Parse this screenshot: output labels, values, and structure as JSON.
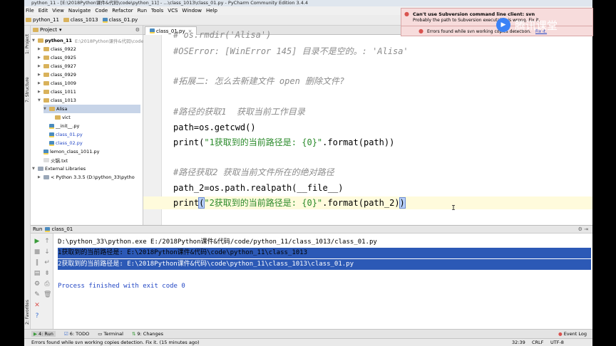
{
  "window": {
    "title": "python_11 - [E:\\2018Python课件&代码\\code\\python_11] - ...\\class_1013\\class_01.py - PyCharm Community Edition 3.4.4"
  },
  "menu": [
    "File",
    "Edit",
    "View",
    "Navigate",
    "Code",
    "Refactor",
    "Run",
    "Tools",
    "VCS",
    "Window",
    "Help"
  ],
  "breadcrumbs": [
    "python_11",
    "class_1013",
    "class_01.py"
  ],
  "project": {
    "header": "Project",
    "root": "python_11",
    "root_path": "E:\\2018Python课件&代码\\code\\python_11",
    "folders": [
      "class_0922",
      "class_0925",
      "class_0927",
      "class_0929",
      "class_1009",
      "class_1011",
      "class_1013"
    ],
    "alisa": "Alisa",
    "vict": "vict",
    "files": [
      "__init__.py",
      "class_01.py",
      "class_02.py"
    ],
    "lemon": "lemon_class_1011.py",
    "txt": "火锅.txt",
    "ext": "External Libraries",
    "py": "< Python 3.3.5 (D:\\python_33\\pytho"
  },
  "editor": {
    "tab": "class_01.py",
    "lines": {
      "l0": "# os.rmdir('Alisa')",
      "l1": "#OSError: [WinError 145] 目录不是空的。: 'Alisa'",
      "l2": "#拓展二: 怎么去新建文件 open 删除文件?",
      "l3": "#路径的获取1  获取当前工作目录",
      "l4": "path=os.getcwd()",
      "l5a": "print(",
      "l5s": "\"1获取到的当前路径是: {0}\"",
      "l5b": ".format(path))",
      "l6": "#路径获取2 获取当前文件所在的绝对路径",
      "l7": "path_2=os.path.realpath(__file__)",
      "l8a": "print",
      "l8p": "(",
      "l8s": "\"2获取到的当前路径是: {0}\"",
      "l8b": ".format(path_2)",
      "l8c": ")"
    }
  },
  "run": {
    "label": "Run",
    "config": "class_01",
    "console": [
      "D:\\python_33\\python.exe E:/2018Python课件&代码/code/python_11/class_1013/class_01.py",
      "1获取到的当前路径是: E:\\2018Python课件&代码\\code\\python_11\\class_1013",
      "2获取到的当前路径是: E:\\2018Python课件&代码\\code\\python_11\\class_1013\\class_01.py",
      "Process finished with exit code 0"
    ]
  },
  "left_tabs": {
    "project": "1: Project",
    "structure": "7: Structure",
    "favorites": "2: Favorites"
  },
  "bottom_tabs": [
    "4: Run",
    "6: TODO",
    "Terminal",
    "9: Changes"
  ],
  "event_log": "Event Log",
  "notification": {
    "title": "Can't use Subversion command line client: svn",
    "body": "Probably the path to Subversion executable is wrong. Fix it.",
    "error": "Errors found while svn working copies detection.",
    "fix": "Fix it."
  },
  "watermark": "腾讯课堂",
  "status": {
    "message": "Errors found while svn working copies detection. Fix it. (15 minutes ago)",
    "position": "32:39",
    "crlf": "CRLF",
    "encoding": "UTF-8"
  },
  "colors": {
    "accent": "#2c59b6",
    "error": "#d9534f",
    "string": "#2a8a2a",
    "comment": "#8c8c8c"
  }
}
